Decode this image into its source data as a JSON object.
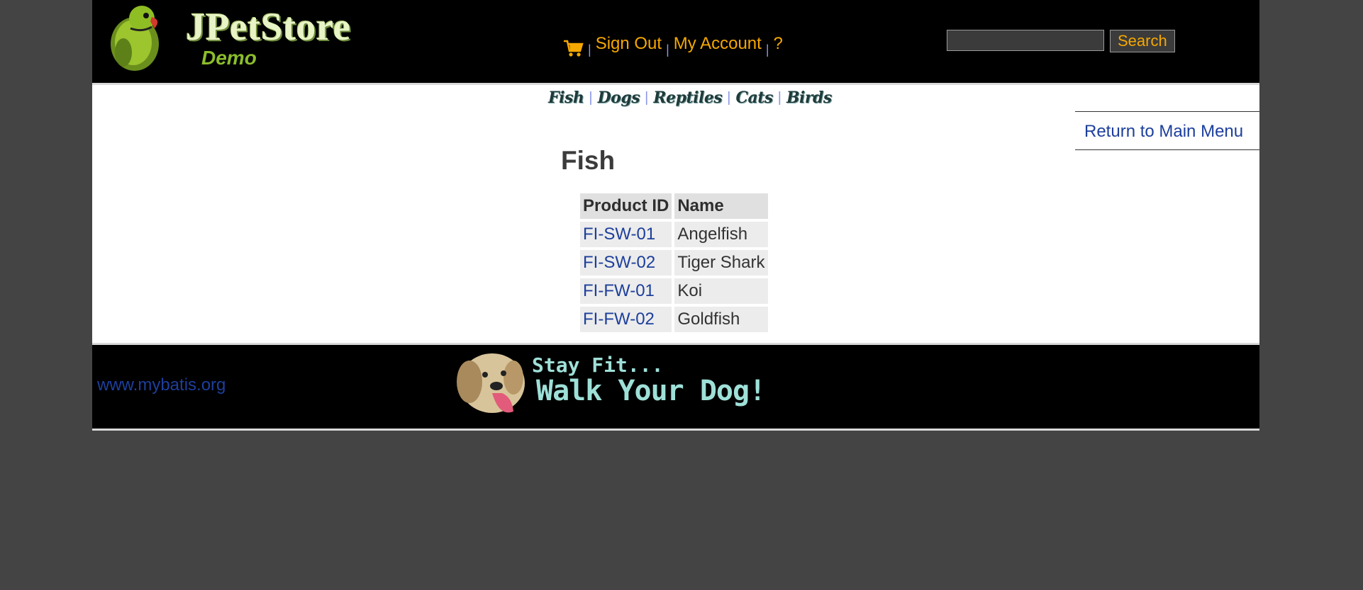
{
  "header": {
    "logo_title": "JPetStore",
    "logo_subtitle": "Demo",
    "cart_icon": "shopping-cart-icon",
    "sign_out": "Sign Out",
    "my_account": "My Account",
    "help": "?",
    "separator": "|",
    "search": {
      "value": "",
      "button": "Search"
    }
  },
  "quicklinks": [
    "Fish",
    "Dogs",
    "Reptiles",
    "Cats",
    "Birds"
  ],
  "back_link": "Return to Main Menu",
  "catalog": {
    "title": "Fish",
    "columns": [
      "Product ID",
      "Name"
    ],
    "rows": [
      {
        "id": "FI-SW-01",
        "name": "Angelfish"
      },
      {
        "id": "FI-SW-02",
        "name": "Tiger Shark"
      },
      {
        "id": "FI-FW-01",
        "name": "Koi"
      },
      {
        "id": "FI-FW-02",
        "name": "Goldfish"
      }
    ]
  },
  "footer": {
    "link": "www.mybatis.org",
    "banner_line1": "Stay Fit...",
    "banner_line2": "Walk Your Dog!"
  },
  "colors": {
    "background": "#444444",
    "header_bg": "#000000",
    "header_link": "#f5a800",
    "link_blue": "#1d3f9c",
    "banner_text": "#9ee0d8"
  }
}
